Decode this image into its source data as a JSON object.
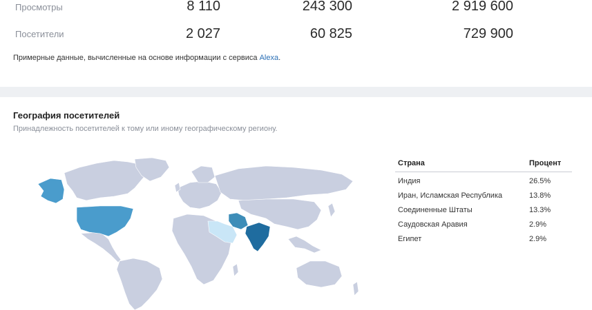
{
  "stats": {
    "rows": [
      {
        "label": "Просмотры",
        "values": [
          "8 110",
          "243 300",
          "2 919 600"
        ]
      },
      {
        "label": "Посетители",
        "values": [
          "2 027",
          "60 825",
          "729 900"
        ]
      }
    ],
    "note_prefix": "Примерные данные, вычисленные на основе информации с сервиса ",
    "note_link": "Alexa",
    "note_suffix": "."
  },
  "geography": {
    "title": "География посетителей",
    "subtitle": "Принадлежность посетителей к тому или иному географическому региону.",
    "map_colors": {
      "land": "#c9cfe0",
      "india": "#1f6c9f",
      "iran": "#3d8db8",
      "usa": "#4a9ccc",
      "light": "#c9e6f7",
      "border": "#ffffff"
    },
    "table": {
      "col_country": "Страна",
      "col_percent": "Процент",
      "rows": [
        {
          "country": "Индия",
          "percent": "26.5%"
        },
        {
          "country": "Иран, Исламская Республика",
          "percent": "13.8%"
        },
        {
          "country": "Соединенные Штаты",
          "percent": "13.3%"
        },
        {
          "country": "Саудовская Аравия",
          "percent": "2.9%"
        },
        {
          "country": "Египет",
          "percent": "2.9%"
        }
      ]
    }
  }
}
